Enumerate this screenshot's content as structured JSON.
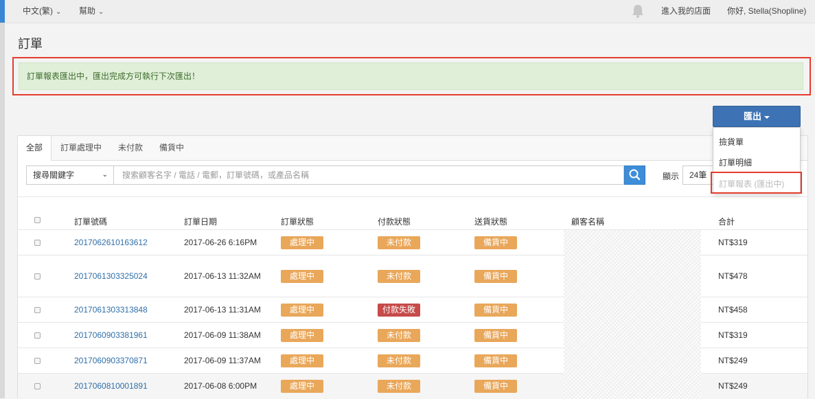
{
  "topbar": {
    "language": "中文(繁)",
    "help": "幫助",
    "store_link": "進入我的店面",
    "greeting": "你好, Stella(Shopline)"
  },
  "page_title": "訂單",
  "alert_message": "訂單報表匯出中，匯出完成方可執行下次匯出！",
  "export": {
    "button_label": "匯出",
    "menu": [
      "撿貨單",
      "訂單明細",
      "訂單報表 (匯出中)"
    ]
  },
  "tabs": [
    "全部",
    "訂單處理中",
    "未付款",
    "備貨中"
  ],
  "search": {
    "select_value": "搜尋關鍵字",
    "placeholder": "搜索顧客名字 / 電話 / 電郵，訂單號碼，或產品名稱",
    "show_label": "顯示",
    "show_value": "24筆"
  },
  "table": {
    "headers": [
      "訂單號碼",
      "訂單日期",
      "訂單狀態",
      "付款狀態",
      "送貨狀態",
      "顧客名稱",
      "合計"
    ],
    "rows": [
      {
        "id": "2017062610163612",
        "date": "2017-06-26 6:16PM",
        "status": "處理中",
        "payment": "未付款",
        "shipping": "備貨中",
        "total": "NT$319"
      },
      {
        "id": "2017061303325024",
        "date": "2017-06-13 11:32AM",
        "status": "處理中",
        "payment": "未付款",
        "shipping": "備貨中",
        "total": "NT$478"
      },
      {
        "id": "2017061303313848",
        "date": "2017-06-13 11:31AM",
        "status": "處理中",
        "payment": "付款失敗",
        "shipping": "備貨中",
        "total": "NT$458"
      },
      {
        "id": "2017060903381961",
        "date": "2017-06-09 11:38AM",
        "status": "處理中",
        "payment": "未付款",
        "shipping": "備貨中",
        "total": "NT$319"
      },
      {
        "id": "2017060903370871",
        "date": "2017-06-09 11:37AM",
        "status": "處理中",
        "payment": "未付款",
        "shipping": "備貨中",
        "total": "NT$249"
      },
      {
        "id": "2017060810001891",
        "date": "2017-06-08 6:00PM",
        "status": "處理中",
        "payment": "未付款",
        "shipping": "備貨中",
        "total": "NT$249"
      }
    ]
  },
  "colors": {
    "primary": "#3d73b5",
    "alert_bg": "#e0efd8",
    "badge_orange": "#e9a75a",
    "badge_red": "#c64b4a",
    "highlight_outline": "#e53b2c"
  }
}
